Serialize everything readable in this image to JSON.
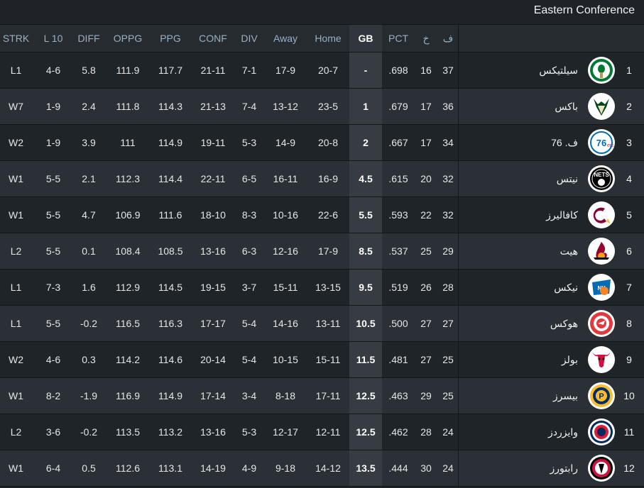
{
  "conference_title": "Eastern Conference",
  "columns": {
    "strk": "STRK",
    "l10": "L 10",
    "diff": "DIFF",
    "oppg": "OPPG",
    "ppg": "PPG",
    "conf": "CONF",
    "div": "DIV",
    "away": "Away",
    "home": "Home",
    "gb": "GB",
    "pct": "PCT",
    "l": "خ",
    "w": "ف"
  },
  "teams": [
    {
      "rank": "1",
      "name": "سيلتيكس",
      "logo": "celtics-logo",
      "w": "37",
      "l": "16",
      "pct": ".698",
      "gb": "-",
      "home": "20-7",
      "away": "17-9",
      "div": "7-1",
      "conf": "21-11",
      "ppg": "117.7",
      "oppg": "111.9",
      "diff": "5.8",
      "l10": "4-6",
      "strk": "L1"
    },
    {
      "rank": "2",
      "name": "باكس",
      "logo": "bucks-logo",
      "w": "36",
      "l": "17",
      "pct": ".679",
      "gb": "1",
      "home": "23-5",
      "away": "13-12",
      "div": "7-4",
      "conf": "21-13",
      "ppg": "114.3",
      "oppg": "111.8",
      "diff": "2.4",
      "l10": "1-9",
      "strk": "W7"
    },
    {
      "rank": "3",
      "name": "ف. 76",
      "logo": "76ers-logo",
      "w": "34",
      "l": "17",
      "pct": ".667",
      "gb": "2",
      "home": "20-8",
      "away": "14-9",
      "div": "5-3",
      "conf": "19-11",
      "ppg": "114.9",
      "oppg": "111",
      "diff": "3.9",
      "l10": "1-9",
      "strk": "W2"
    },
    {
      "rank": "4",
      "name": "نيتس",
      "logo": "nets-logo",
      "w": "32",
      "l": "20",
      "pct": ".615",
      "gb": "4.5",
      "home": "16-9",
      "away": "16-11",
      "div": "6-5",
      "conf": "22-11",
      "ppg": "114.4",
      "oppg": "112.3",
      "diff": "2.1",
      "l10": "5-5",
      "strk": "W1"
    },
    {
      "rank": "5",
      "name": "كافاليرز",
      "logo": "cavaliers-logo",
      "w": "32",
      "l": "22",
      "pct": ".593",
      "gb": "5.5",
      "home": "22-6",
      "away": "10-16",
      "div": "8-3",
      "conf": "18-10",
      "ppg": "111.6",
      "oppg": "106.9",
      "diff": "4.7",
      "l10": "5-5",
      "strk": "W1"
    },
    {
      "rank": "6",
      "name": "هيت",
      "logo": "heat-logo",
      "w": "29",
      "l": "25",
      "pct": ".537",
      "gb": "8.5",
      "home": "17-9",
      "away": "12-16",
      "div": "6-3",
      "conf": "13-16",
      "ppg": "108.5",
      "oppg": "108.4",
      "diff": "0.1",
      "l10": "5-5",
      "strk": "L2"
    },
    {
      "rank": "7",
      "name": "نيكس",
      "logo": "knicks-logo",
      "w": "28",
      "l": "26",
      "pct": ".519",
      "gb": "9.5",
      "home": "13-15",
      "away": "15-11",
      "div": "3-7",
      "conf": "19-15",
      "ppg": "114.5",
      "oppg": "112.9",
      "diff": "1.6",
      "l10": "7-3",
      "strk": "L1"
    },
    {
      "rank": "8",
      "name": "هوكس",
      "logo": "hawks-logo",
      "w": "27",
      "l": "27",
      "pct": ".500",
      "gb": "10.5",
      "home": "13-11",
      "away": "14-16",
      "div": "5-4",
      "conf": "17-17",
      "ppg": "116.3",
      "oppg": "116.5",
      "diff": "-0.2",
      "l10": "5-5",
      "strk": "L1"
    },
    {
      "rank": "9",
      "name": "بولز",
      "logo": "bulls-logo",
      "w": "25",
      "l": "27",
      "pct": ".481",
      "gb": "11.5",
      "home": "15-11",
      "away": "10-15",
      "div": "5-4",
      "conf": "20-14",
      "ppg": "114.6",
      "oppg": "114.2",
      "diff": "0.3",
      "l10": "4-6",
      "strk": "W2"
    },
    {
      "rank": "10",
      "name": "بيسرز",
      "logo": "pacers-logo",
      "w": "25",
      "l": "29",
      "pct": ".463",
      "gb": "12.5",
      "home": "17-11",
      "away": "8-18",
      "div": "3-4",
      "conf": "17-14",
      "ppg": "114.9",
      "oppg": "116.9",
      "diff": "-1.9",
      "l10": "8-2",
      "strk": "W1"
    },
    {
      "rank": "11",
      "name": "وايزردز",
      "logo": "wizards-logo",
      "w": "24",
      "l": "28",
      "pct": ".462",
      "gb": "12.5",
      "home": "12-11",
      "away": "12-17",
      "div": "5-3",
      "conf": "13-16",
      "ppg": "113.2",
      "oppg": "113.5",
      "diff": "-0.2",
      "l10": "3-6",
      "strk": "L2"
    },
    {
      "rank": "12",
      "name": "رابتورز",
      "logo": "raptors-logo",
      "w": "24",
      "l": "30",
      "pct": ".444",
      "gb": "13.5",
      "home": "14-12",
      "away": "9-18",
      "div": "4-9",
      "conf": "14-19",
      "ppg": "113.1",
      "oppg": "112.6",
      "diff": "0.5",
      "l10": "6-4",
      "strk": "W1"
    }
  ]
}
